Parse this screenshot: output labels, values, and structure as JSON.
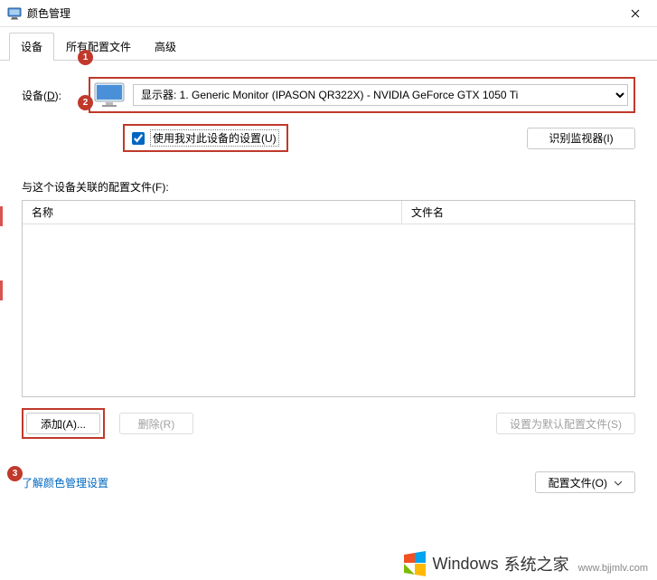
{
  "title": "颜色管理",
  "close_tooltip": "Close",
  "tabs": {
    "device": "设备",
    "all_profiles": "所有配置文件",
    "advanced": "高级"
  },
  "device": {
    "label_prefix": "设备(",
    "label_uchar": "D",
    "label_suffix": "):",
    "selected": "显示器: 1. Generic Monitor (IPASON QR322X) - NVIDIA GeForce GTX 1050 Ti"
  },
  "use_settings": {
    "checkbox_checked": true,
    "label": "使用我对此设备的设置(U)"
  },
  "identify_btn": "识别监视器(I)",
  "profiles_label": "与这个设备关联的配置文件(F):",
  "columns": {
    "name": "名称",
    "filename": "文件名"
  },
  "buttons": {
    "add": "添加(A)...",
    "remove": "删除(R)",
    "set_default": "设置为默认配置文件(S)",
    "profiles_menu": "配置文件(O)"
  },
  "link": "了解颜色管理设置",
  "badges": {
    "b1": "1",
    "b2": "2",
    "b3": "3"
  },
  "watermark": {
    "brand1": "Windows",
    "brand2": "系统之家",
    "url": "www.bjjmlv.com"
  }
}
